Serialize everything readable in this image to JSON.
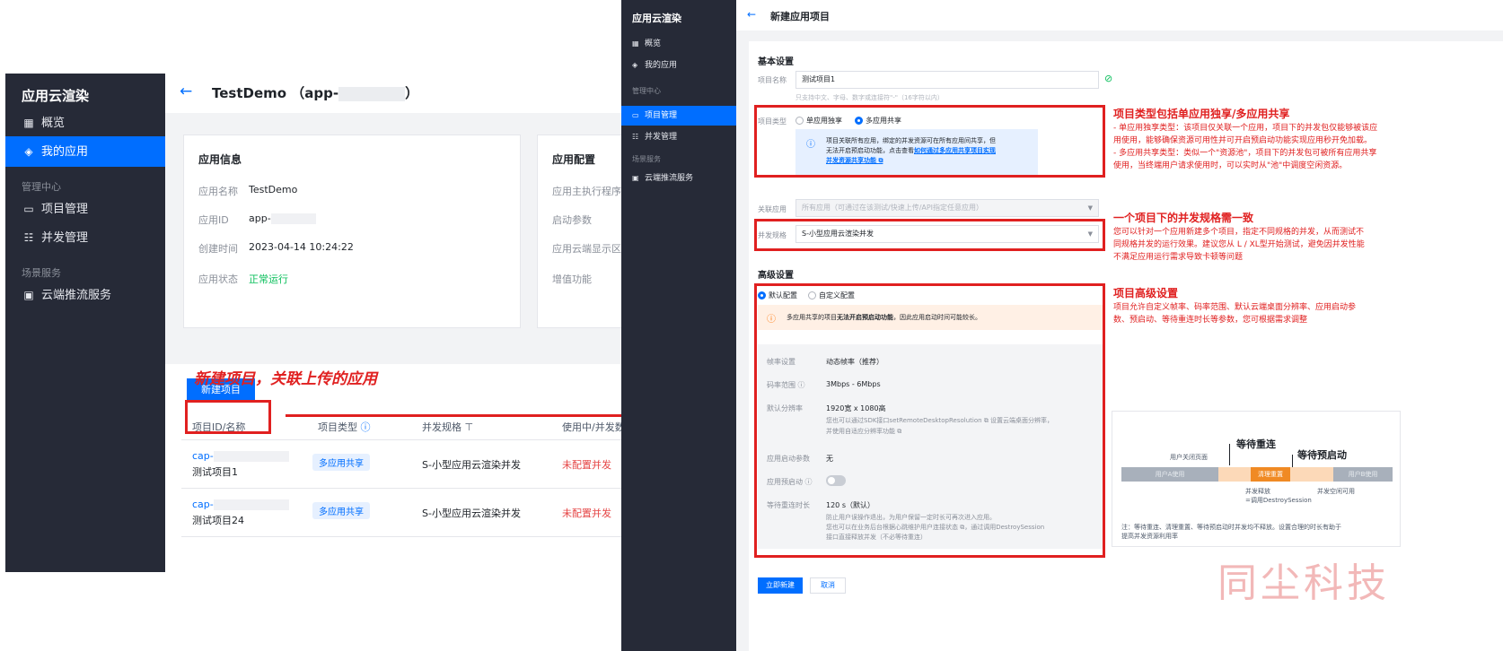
{
  "left": {
    "sidebar": {
      "brand": "应用云渲染",
      "items": [
        {
          "icon": "grid-icon",
          "glyph": "▦",
          "label": "概览"
        },
        {
          "icon": "layers-icon",
          "glyph": "◈",
          "label": "我的应用"
        }
      ],
      "group_manage": "管理中心",
      "manage_items": [
        {
          "icon": "folder-icon",
          "glyph": "▭",
          "label": "项目管理"
        },
        {
          "icon": "list-icon",
          "glyph": "☷",
          "label": "并发管理"
        }
      ],
      "group_scene": "场景服务",
      "scene_items": [
        {
          "icon": "stream-icon",
          "glyph": "▣",
          "label": "云端推流服务"
        }
      ]
    },
    "header": {
      "back": "←",
      "title_prefix": "TestDemo （app-",
      "title_suffix": "）"
    },
    "app_info": {
      "title": "应用信息",
      "fields": [
        {
          "key": "应用名称",
          "value": "TestDemo"
        },
        {
          "key": "应用ID",
          "value": "app-"
        },
        {
          "key": "创建时间",
          "value": "2023-04-14 10:24:22"
        },
        {
          "key": "应用状态",
          "value": "正常运行"
        }
      ]
    },
    "app_config": {
      "title": "应用配置",
      "fields": [
        "应用主执行程序路",
        "启动参数",
        "应用云端显示区域",
        "增值功能"
      ]
    },
    "annotation": "新建项目，关联上传的应用",
    "new_project_button": "新建项目",
    "table": {
      "columns": [
        "项目ID/名称",
        "项目类型",
        "并发规格",
        "使用中/并发数"
      ],
      "rows": [
        {
          "id": "cap-",
          "name": "测试项目1",
          "type": "多应用共享",
          "spec": "S-小型应用云渲染并发",
          "status": "未配置并发"
        },
        {
          "id": "cap-",
          "name": "测试项目24",
          "type": "多应用共享",
          "spec": "S-小型应用云渲染并发",
          "status": "未配置并发"
        }
      ]
    }
  },
  "right": {
    "sidebar": {
      "brand": "应用云渲染",
      "items": [
        {
          "glyph": "▦",
          "label": "概览"
        },
        {
          "glyph": "◈",
          "label": "我的应用"
        }
      ],
      "group_manage": "管理中心",
      "manage_items": [
        {
          "glyph": "▭",
          "label": "项目管理"
        },
        {
          "glyph": "☷",
          "label": "并发管理"
        }
      ],
      "group_scene": "场景服务",
      "scene_items": [
        {
          "glyph": "▣",
          "label": "云端推流服务"
        }
      ]
    },
    "header": {
      "back": "←",
      "title": "新建应用项目"
    },
    "basic": {
      "title": "基本设置",
      "name_label": "项目名称",
      "name_value": "测试项目1",
      "name_hint": "只支持中文、字母、数字或连接符\"-\"（16字符以内）",
      "type_label": "项目类型",
      "type_opt1": "单应用独享",
      "type_opt2": "多应用共享",
      "info_line1": "项目关联所有应用，绑定的并发资源可在所有应用间共享，但",
      "info_line2": "无法开启预启动功能，点击查看",
      "info_link": "如何通过多应用共享项目实现",
      "info_link2": "并发资源共享功能",
      "app_label": "关联应用",
      "app_placeholder": "所有应用（可通过在该测试/快速上传/API指定任意应用）",
      "spec_label": "并发规格",
      "spec_value": "S-小型应用云渲染并发"
    },
    "advanced": {
      "title": "高级设置",
      "opt_default": "默认配置",
      "opt_custom": "自定义配置",
      "warning_prefix": "多应用共享的项目",
      "warning_bold": "无法开启预启动功能",
      "warning_suffix": "，因此应用启动时间可能较长。",
      "rows": [
        {
          "key": "帧率设置",
          "value": "动态帧率（推荐）"
        },
        {
          "key": "码率范围",
          "value": "3Mbps - 6Mbps"
        },
        {
          "key": "默认分辨率",
          "value": "1920宽 x 1080高"
        },
        {
          "key": "应用启动参数",
          "value": "无"
        },
        {
          "key": "应用预启动",
          "value": ""
        },
        {
          "key": "等待重连时长",
          "value": "120 s（默认）"
        }
      ],
      "res_hint1": "您也可以通过SDK接口setRemoteDesktopResolution",
      "res_hint1b": "设置云端桌面分辨率，",
      "res_hint2": "并使用自适应分辨率功能",
      "reconnect_hint1": "防止用户误操作退出，为用户保留一定时长可再次进入应用。",
      "reconnect_hint2": "您也可以在业务后台根据心跳维护用户连接状态",
      "reconnect_hint2b": "，通过调用DestroySession",
      "reconnect_hint3": "接口直接释放并发（不必等待重连）"
    },
    "annotations": [
      {
        "title": "项目类型包括单应用独享/多应用共享",
        "lines": [
          "- 单应用独享类型：该项目仅关联一个应用，项目下的并发包仅能够被该应",
          "用使用，能够确保资源可用性并可开启预启动功能实现应用秒开免加载。",
          "- 多应用共享类型：类似一个\"资源池\"，项目下的并发包可被所有应用共享",
          "使用，当终端用户请求使用时，可以实时从\"池\"中调度空闲资源。"
        ]
      },
      {
        "title": "一个项目下的并发规格需一致",
        "lines": [
          "您可以针对一个应用新建多个项目，指定不同规格的并发，从而测试不",
          "同规格并发的运行效果。建议您从 L / XL型开始测试，避免因并发性能",
          "不满足应用运行需求导致卡顿等问题"
        ]
      },
      {
        "title": "项目高级设置",
        "lines": [
          "项目允许自定义帧率、码率范围、默认云端桌面分辨率、应用启动参",
          "数、预启动、等待重连时长等参数，您可根据需求调整"
        ]
      }
    ],
    "timeline": {
      "label_wait_reconnect": "等待重连",
      "label_wait_prestart": "等待预启动",
      "label_user_close": "用户关闭页面",
      "seg1": "用户A使用",
      "seg2": "清理重置",
      "seg3": "用户B使用",
      "below1a": "并发释放",
      "below1b": "=调用DestroySession",
      "below2": "并发空闲可用",
      "note1": "注：等待重连、清理重置、等待预启动时并发均不释放。设置合理的时长有助于",
      "note2": "提高并发资源利用率"
    },
    "buttons": {
      "create": "立即新建",
      "cancel": "取消"
    },
    "watermark": "同尘科技"
  },
  "colors": {
    "sidebar": "#262a37",
    "primary": "#006eff",
    "annotation_red": "#e02020",
    "success_green": "#0abf5b",
    "warning_bg": "#fff0e5"
  }
}
